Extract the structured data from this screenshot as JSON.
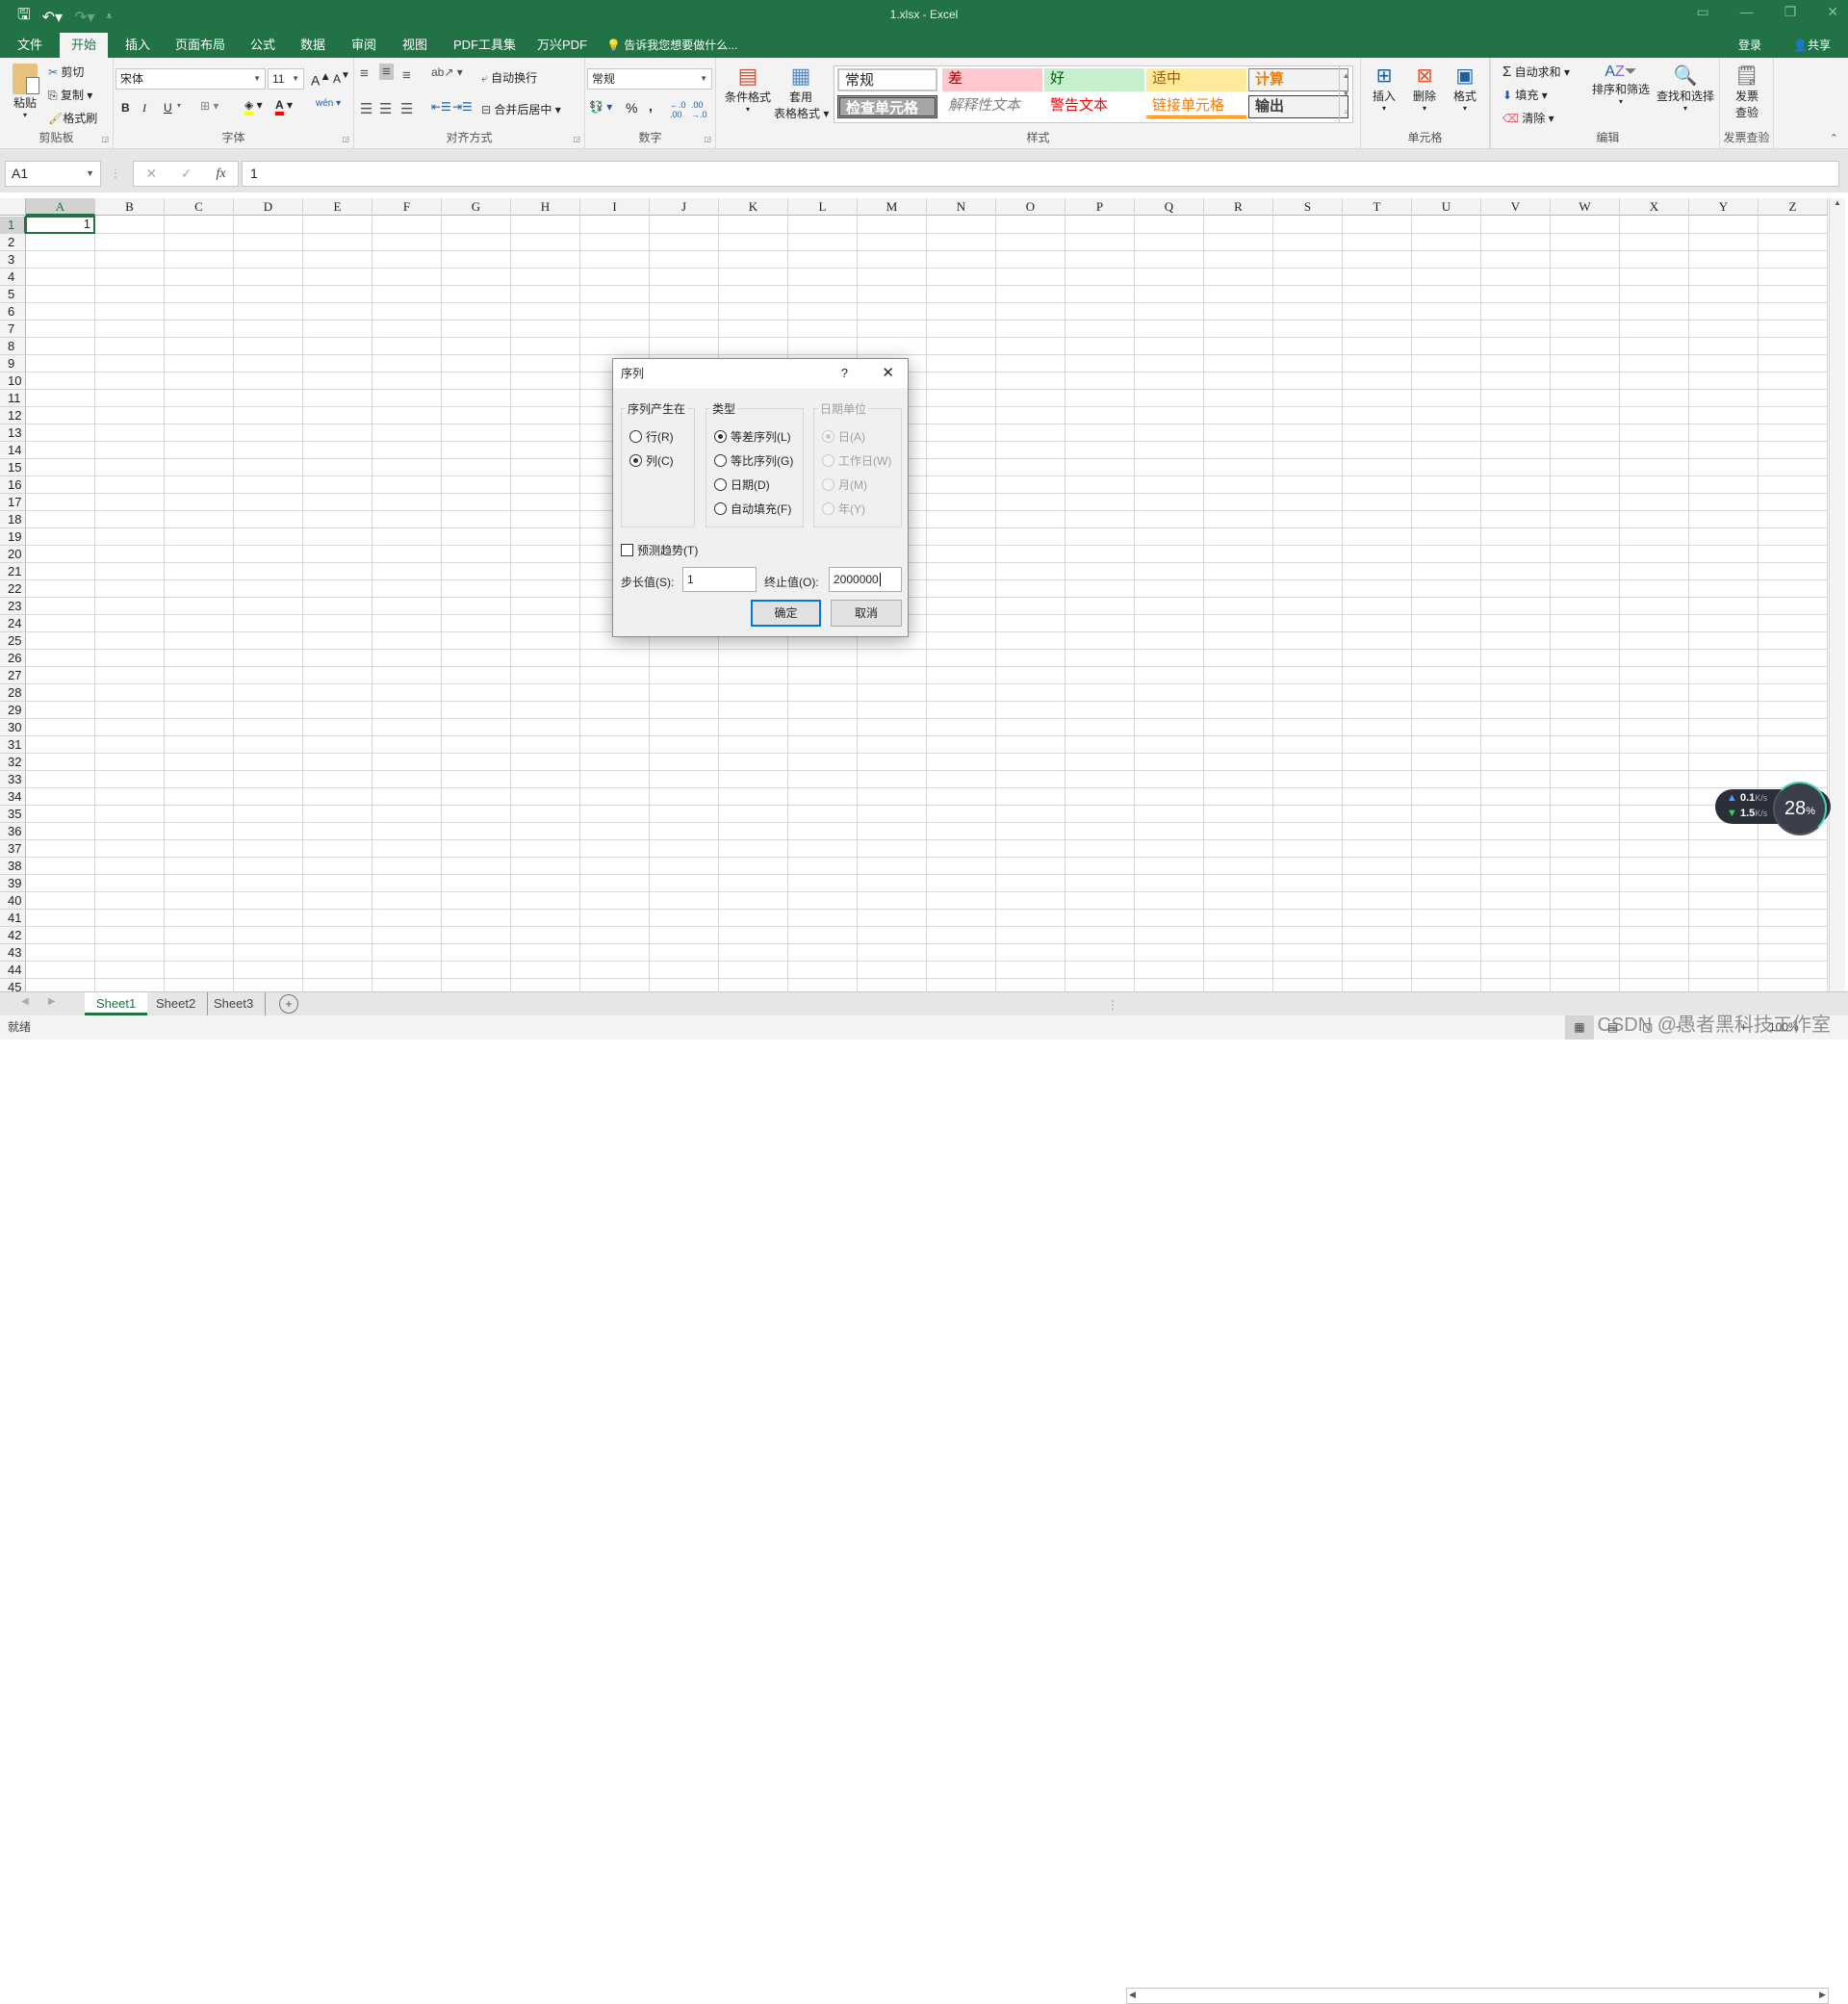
{
  "window": {
    "title": "1.xlsx - Excel",
    "qat": {
      "save_icon": "save-icon",
      "undo_icon": "undo-icon",
      "redo_icon": "redo-icon",
      "customize_icon": "customize-qat-icon"
    },
    "controls": [
      "ribbon-display-icon",
      "minimize-icon",
      "restore-icon",
      "close-icon"
    ]
  },
  "tabs": [
    {
      "label": "文件"
    },
    {
      "label": "开始",
      "active": true
    },
    {
      "label": "插入"
    },
    {
      "label": "页面布局"
    },
    {
      "label": "公式"
    },
    {
      "label": "数据"
    },
    {
      "label": "审阅"
    },
    {
      "label": "视图"
    },
    {
      "label": "PDF工具集"
    },
    {
      "label": "万兴PDF"
    }
  ],
  "tellme": "告诉我您想要做什么...",
  "signin": "登录",
  "share": "共享",
  "ribbon": {
    "clipboard": {
      "label": "剪贴板",
      "paste": "粘贴",
      "cut": "剪切",
      "copy": "复制",
      "format_painter": "格式刷"
    },
    "font": {
      "label": "字体",
      "font_name": "宋体",
      "font_size": "11",
      "bold": "B",
      "italic": "I",
      "underline": "U",
      "font_color": "#ff0000",
      "fill_color": "#ffff00"
    },
    "alignment": {
      "label": "对齐方式",
      "wrap_text": "自动换行",
      "merge_center": "合并后居中"
    },
    "number": {
      "label": "数字",
      "format": "常规",
      "percent": "%",
      "comma": ","
    },
    "styles": {
      "label": "样式",
      "conditional_format": "条件格式",
      "table_format_1": "套用",
      "table_format_2": "表格格式",
      "cells": [
        {
          "label": "常规",
          "bg": "#ffffff",
          "color": "#000000"
        },
        {
          "label": "差",
          "bg": "#ffc7ce",
          "color": "#9c0006"
        },
        {
          "label": "好",
          "bg": "#c6efce",
          "color": "#006100"
        },
        {
          "label": "适中",
          "bg": "#ffeb9c",
          "color": "#9c5700"
        },
        {
          "label": "计算",
          "bg": "#f2f2f2",
          "color": "#fa7d00"
        },
        {
          "label": "检查单元格",
          "bg": "#a5a5a5",
          "color": "#ffffff"
        },
        {
          "label": "解释性文本",
          "bg": "#ffffff",
          "color": "#7f7f7f"
        },
        {
          "label": "警告文本",
          "bg": "#ffffff",
          "color": "#ff0000"
        },
        {
          "label": "链接单元格",
          "bg": "#ffffff",
          "color": "#fa7d00"
        },
        {
          "label": "输出",
          "bg": "#f2f2f2",
          "color": "#3f3f3f"
        }
      ]
    },
    "cells": {
      "label": "单元格",
      "insert": "插入",
      "delete": "删除",
      "format": "格式"
    },
    "editing": {
      "label": "编辑",
      "autosum": "自动求和",
      "fill": "填充",
      "clear": "清除",
      "sort_filter": "排序和筛选",
      "find_select": "查找和选择"
    },
    "invoice": {
      "label": "发票查验",
      "button_1": "发票",
      "button_2": "查验"
    }
  },
  "formula_bar": {
    "name_box": "A1",
    "cancel": "✕",
    "enter": "✓",
    "fx": "fx",
    "content": "1"
  },
  "sheet": {
    "columns": [
      "A",
      "B",
      "C",
      "D",
      "E",
      "F",
      "G",
      "H",
      "I",
      "J",
      "K",
      "L",
      "M",
      "N",
      "O",
      "P",
      "Q",
      "R",
      "S",
      "T",
      "U",
      "V",
      "W",
      "X",
      "Y",
      "Z"
    ],
    "row_count": 45,
    "active_cell": "A1",
    "A1_value": "1"
  },
  "sheet_tabs": [
    {
      "label": "Sheet1",
      "active": true
    },
    {
      "label": "Sheet2"
    },
    {
      "label": "Sheet3"
    }
  ],
  "status": {
    "ready": "就绪",
    "zoom": "100%"
  },
  "dialog": {
    "title": "序列",
    "help": "?",
    "close": "✕",
    "series_in": {
      "label": "序列产生在",
      "options": [
        {
          "label": "行(R)",
          "checked": false
        },
        {
          "label": "列(C)",
          "checked": true
        }
      ]
    },
    "type": {
      "label": "类型",
      "options": [
        {
          "label": "等差序列(L)",
          "checked": true
        },
        {
          "label": "等比序列(G)",
          "checked": false
        },
        {
          "label": "日期(D)",
          "checked": false
        },
        {
          "label": "自动填充(F)",
          "checked": false
        }
      ]
    },
    "date_unit": {
      "label": "日期单位",
      "disabled": true,
      "options": [
        {
          "label": "日(A)",
          "checked": true
        },
        {
          "label": "工作日(W)",
          "checked": false
        },
        {
          "label": "月(M)",
          "checked": false
        },
        {
          "label": "年(Y)",
          "checked": false
        }
      ]
    },
    "trend": {
      "label": "预测趋势(T)",
      "checked": false
    },
    "step_label": "步长值(S):",
    "step_value": "1",
    "stop_label": "终止值(O):",
    "stop_value": "2000000",
    "ok": "确定",
    "cancel": "取消"
  },
  "net_widget": {
    "upload": "0.1",
    "download": "1.5",
    "unit": "K/s",
    "cpu": "28",
    "cpu_unit": "%"
  },
  "watermark": "CSDN @愚者黑科技工作室"
}
